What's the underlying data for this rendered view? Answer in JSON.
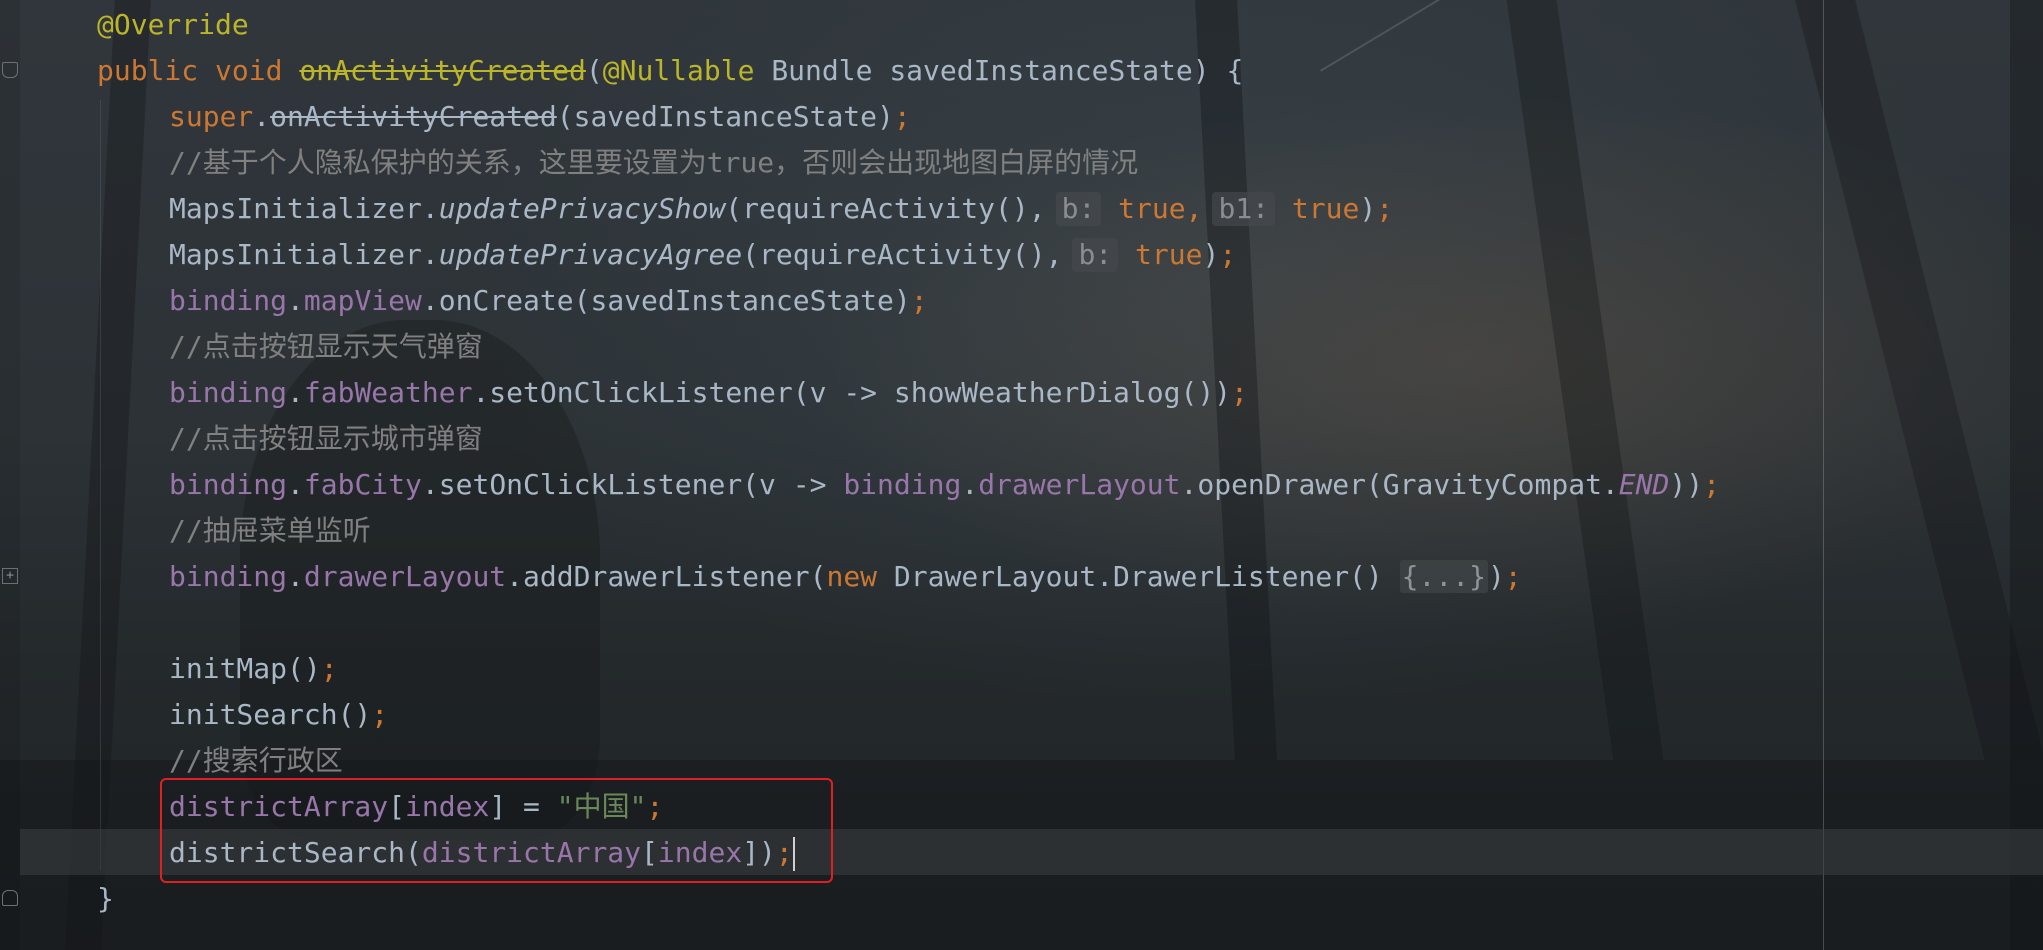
{
  "colors": {
    "keyword": "#cc7832",
    "annotation": "#bbb529",
    "field": "#9876aa",
    "string": "#6a8759",
    "comment": "#808080",
    "text": "#a9b7c6",
    "highlight_box": "#e02020"
  },
  "icons": {
    "fold_collapse": "fold-collapse-icon",
    "fold_expand": "fold-expand-icon",
    "fold_end": "fold-end-icon"
  },
  "code": {
    "line1": {
      "annotation": "@Override"
    },
    "line2": {
      "modifier_public": "public",
      "modifier_void": "void",
      "method_name": "onActivityCreated",
      "paren_open": "(",
      "param_annotation": "@Nullable",
      "param": " Bundle savedInstanceState) {"
    },
    "line3": {
      "super_kw": "super",
      "dot": ".",
      "method": "onActivityCreated",
      "args": "(savedInstanceState)",
      "semi": ";"
    },
    "line4": {
      "comment": "//基于个人隐私保护的关系，这里要设置为true，否则会出现地图白屏的情况"
    },
    "line5": {
      "cls": "MapsInitializer.",
      "method": "updatePrivacyShow",
      "args_start": "(requireActivity(),",
      "hint_b": "b:",
      "val_b": "true",
      "comma": ",",
      "hint_b1": "b1:",
      "val_b1": "true",
      "close": ")",
      "semi": ";"
    },
    "line6": {
      "cls": "MapsInitializer.",
      "method": "updatePrivacyAgree",
      "args_start": "(requireActivity(),",
      "hint_b": "b:",
      "val_b": "true",
      "close": ")",
      "semi": ";"
    },
    "line7": {
      "binding": "binding",
      "dot": ".",
      "field": "mapView",
      "rest": ".onCreate(savedInstanceState)",
      "semi": ";"
    },
    "line8": {
      "comment": "//点击按钮显示天气弹窗"
    },
    "line9": {
      "binding": "binding",
      "dot": ".",
      "field": "fabWeather",
      "rest": ".setOnClickListener(v -> showWeatherDialog())",
      "semi": ";"
    },
    "line10": {
      "comment": "//点击按钮显示城市弹窗"
    },
    "line11": {
      "binding": "binding",
      "dot": ".",
      "field": "fabCity",
      "rest": ".setOnClickListener(v -> ",
      "binding2": "binding",
      "dot2": ".",
      "field2": "drawerLayout",
      "rest2": ".openDrawer(GravityCompat.",
      "constant": "END",
      "close": "))",
      "semi": ";"
    },
    "line12": {
      "comment": "//抽屉菜单监听"
    },
    "line13": {
      "binding": "binding",
      "dot": ".",
      "field": "drawerLayout",
      "rest": ".addDrawerListener(",
      "new_kw": "new",
      "rest2": " DrawerLayout.DrawerListener() ",
      "folded": "{...}",
      "close": ")",
      "semi": ";"
    },
    "line14": {
      "call": "initMap()",
      "semi": ";"
    },
    "line15": {
      "call": "initSearch()",
      "semi": ";"
    },
    "line16": {
      "comment": "//搜索行政区"
    },
    "line17": {
      "field": "districtArray",
      "bracket_open": "[",
      "index": "index",
      "rest": "] = ",
      "string": "\"中国\"",
      "semi": ";"
    },
    "line18": {
      "call": "districtSearch(",
      "field": "districtArray",
      "bracket_open": "[",
      "index": "index",
      "close": "])",
      "semi": ";"
    },
    "line19": {
      "brace": "}"
    }
  }
}
